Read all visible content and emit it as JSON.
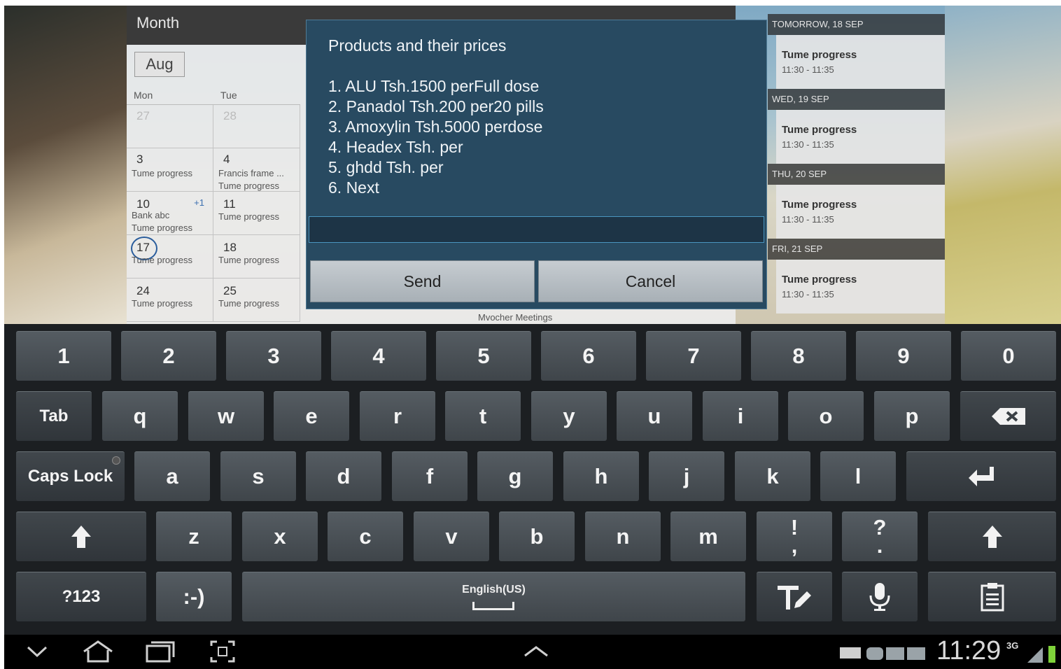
{
  "calendar": {
    "title": "Month",
    "month_button": "Aug",
    "weekdays": [
      "Mon",
      "Tue"
    ],
    "cells": [
      {
        "num": "27",
        "dim": true,
        "events": []
      },
      {
        "num": "28",
        "dim": true,
        "events": []
      },
      {
        "num": "3",
        "events": [
          "Tume progress"
        ]
      },
      {
        "num": "4",
        "events": [
          "Francis frame ...",
          "Tume progress"
        ]
      },
      {
        "num": "10",
        "more": "+1",
        "events": [
          "Bank abc",
          "Tume progress"
        ]
      },
      {
        "num": "11",
        "events": [
          "Tume progress"
        ]
      },
      {
        "num": "17",
        "today": true,
        "events": [
          "Tume progress"
        ]
      },
      {
        "num": "18",
        "events": [
          "Tume progress"
        ]
      },
      {
        "num": "24",
        "events": [
          "Tume progress"
        ]
      },
      {
        "num": "25",
        "events": [
          "Tume progress"
        ]
      }
    ],
    "other_event": "Mvocher Meetings"
  },
  "agenda": [
    {
      "header": "TOMORROW, 18 SEP",
      "title": "Tume progress",
      "time": "11:30 - 11:35"
    },
    {
      "header": "WED, 19 SEP",
      "title": "Tume progress",
      "time": "11:30 - 11:35"
    },
    {
      "header": "THU, 20 SEP",
      "title": "Tume progress",
      "time": "11:30 - 11:35"
    },
    {
      "header": "FRI, 21 SEP",
      "title": "Tume progress",
      "time": "11:30 - 11:35"
    }
  ],
  "dialog": {
    "message": "Products and their prices\n\n1. ALU Tsh.1500 perFull dose\n2. Panadol Tsh.200 per20 pills\n3. Amoxylin Tsh.5000 perdose\n4. Headex Tsh. per\n5. ghdd Tsh. per\n6. Next",
    "input_value": "",
    "send_label": "Send",
    "cancel_label": "Cancel"
  },
  "keyboard": {
    "row1": [
      "1",
      "2",
      "3",
      "4",
      "5",
      "6",
      "7",
      "8",
      "9",
      "0"
    ],
    "row2": [
      "Tab",
      "q",
      "w",
      "e",
      "r",
      "t",
      "y",
      "u",
      "i",
      "o",
      "p"
    ],
    "row3": [
      "Caps Lock",
      "a",
      "s",
      "d",
      "f",
      "g",
      "h",
      "j",
      "k",
      "l"
    ],
    "row4": [
      "z",
      "x",
      "c",
      "v",
      "b",
      "n",
      "m"
    ],
    "row5": [
      "?123",
      ":-)"
    ],
    "punct1_top": "!",
    "punct1_bottom": ",",
    "punct2_top": "?",
    "punct2_bottom": ".",
    "language": "English(US)",
    "icons": [
      "backspace-icon",
      "enter-icon",
      "shift-icon",
      "text-format-icon",
      "microphone-icon",
      "clipboard-icon"
    ]
  },
  "status": {
    "time": "11:29",
    "network": "3G"
  }
}
